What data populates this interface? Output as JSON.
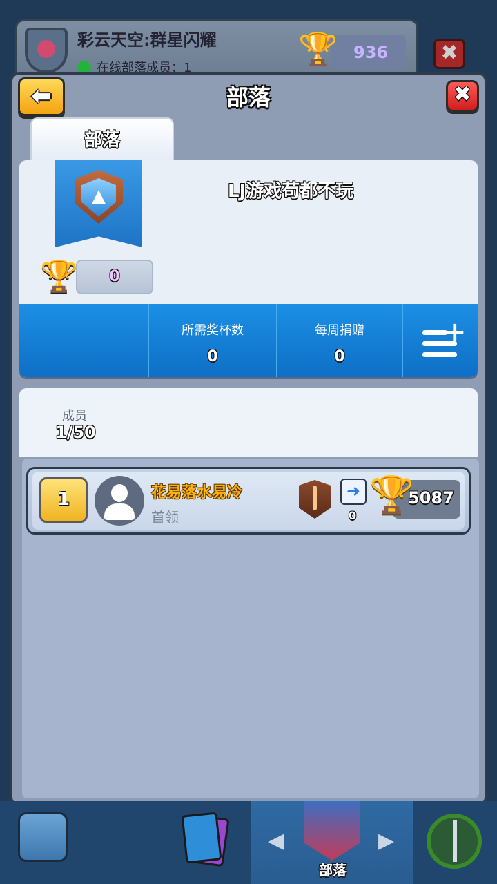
{
  "background": {
    "clan_name": "彩云天空:群星闪耀",
    "online_text": "在线部落成员：1",
    "trophies": "936",
    "close_icon": "close-icon"
  },
  "dialog": {
    "title": "部落",
    "back_icon": "back-arrow-icon",
    "close_icon": "close-icon",
    "tab_label": "部落"
  },
  "clan": {
    "name": "LJ游戏苟都不玩",
    "trophies": "0",
    "required_trophies_label": "所需奖杯数",
    "required_trophies_value": "0",
    "weekly_donations_label": "每周捐赠",
    "weekly_donations_value": "0"
  },
  "members": {
    "label": "成员",
    "count": "1/50",
    "list": [
      {
        "rank": "1",
        "name": "花易落水易冷",
        "role": "首领",
        "donations": "0",
        "trophies": "5087"
      }
    ]
  },
  "bottom_nav": {
    "active_label": "部落"
  },
  "colors": {
    "dialog_bg": "#8e9db3",
    "stats_bar": "#1c8fe4",
    "member_name": "#ffb114",
    "back_button": "#f5a311",
    "close_button": "#d11d1d"
  }
}
